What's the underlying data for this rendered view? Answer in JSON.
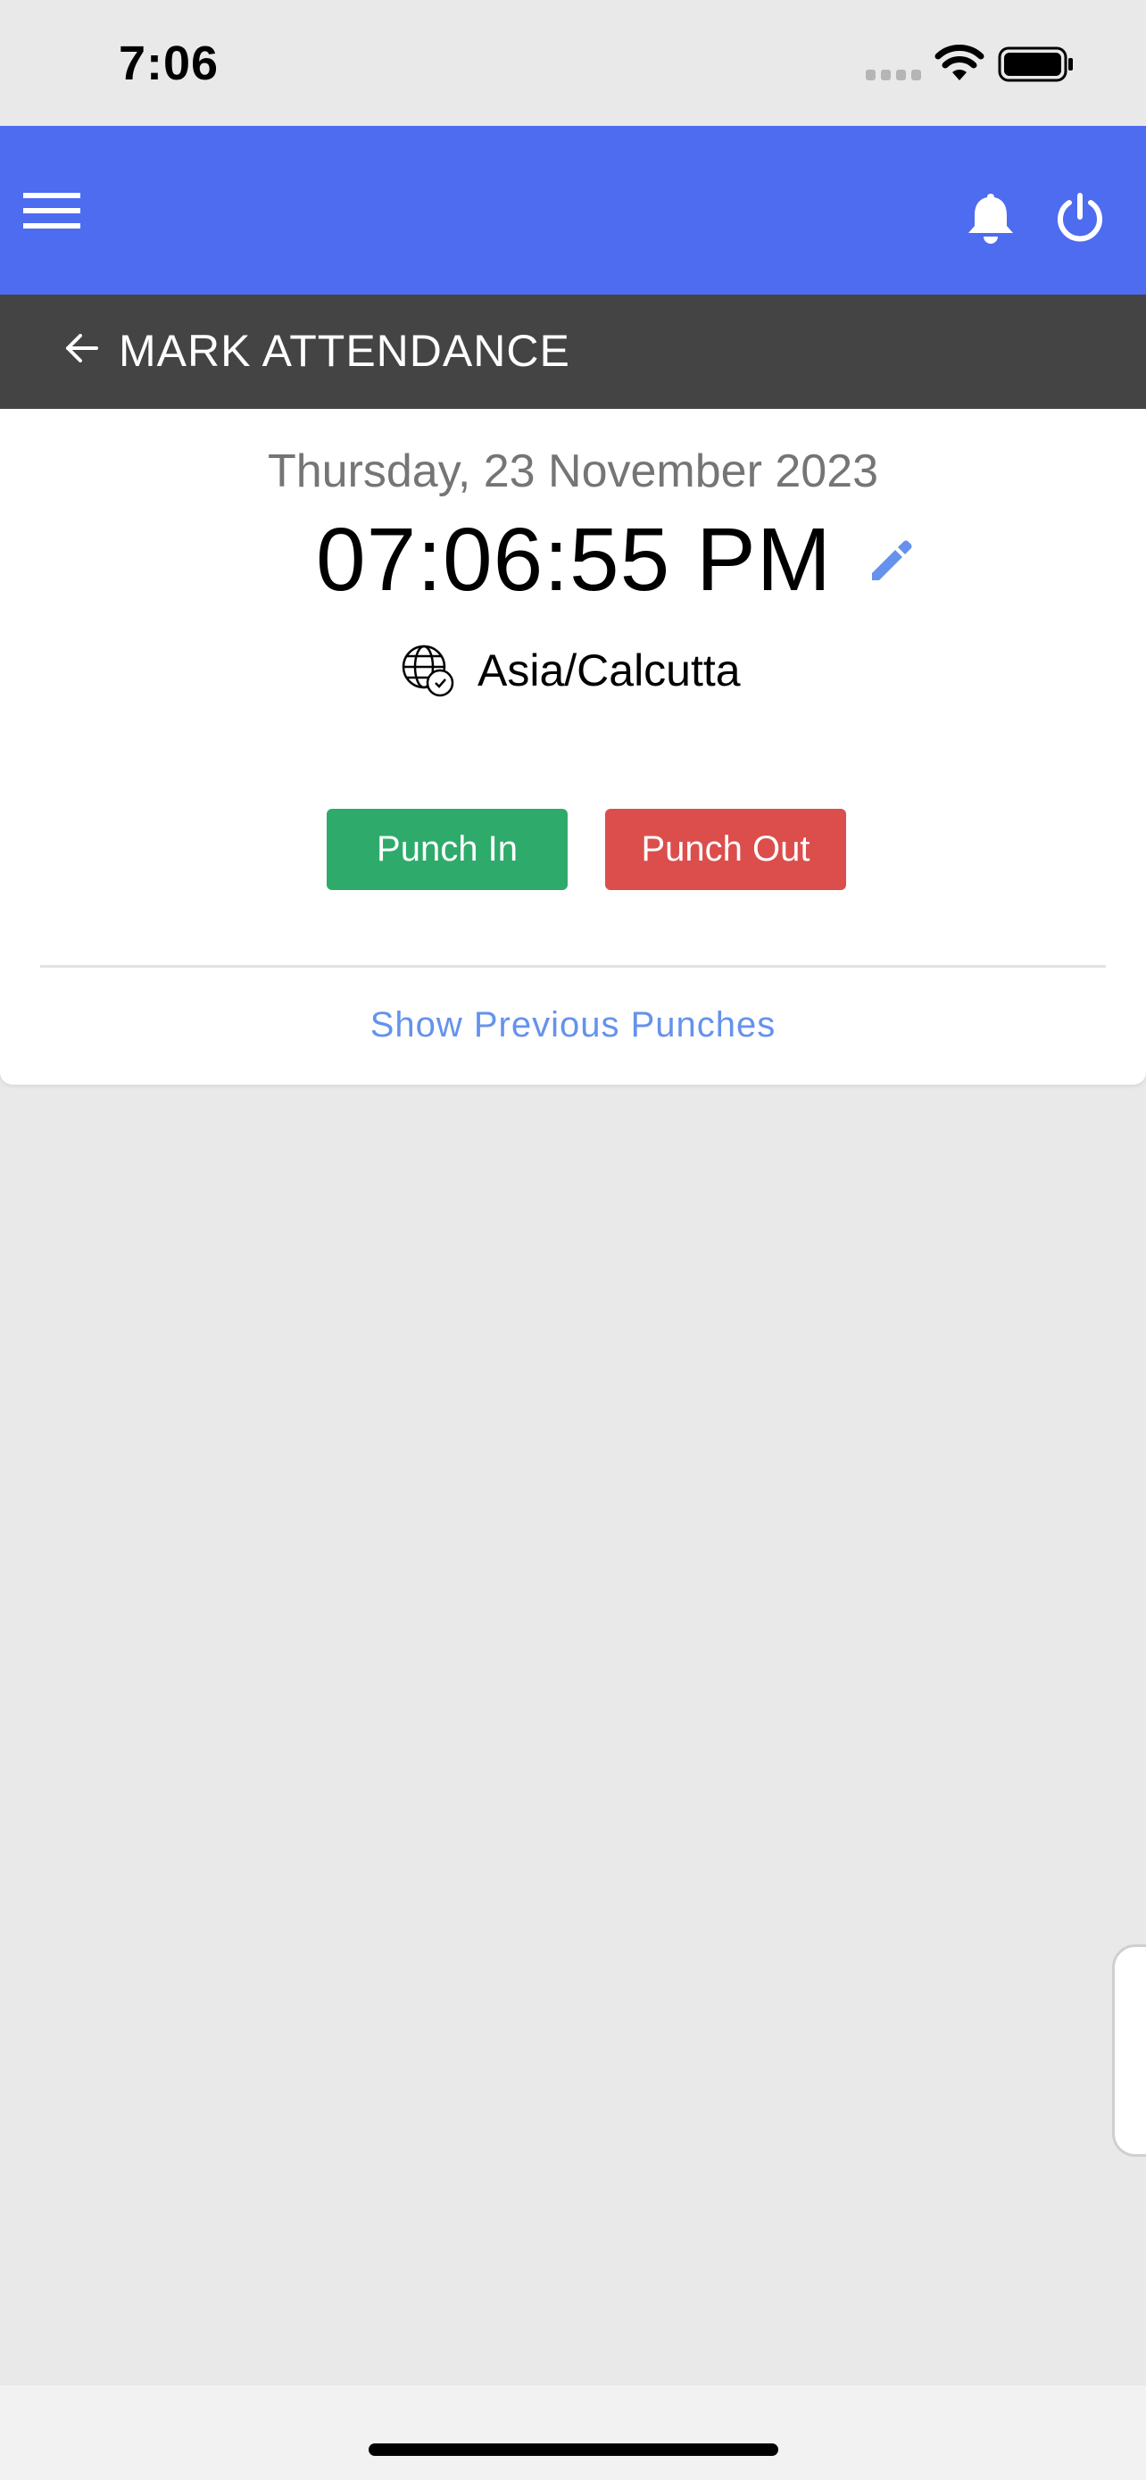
{
  "status_bar": {
    "time": "7:06"
  },
  "app_bar": {
    "background_color": "#4e6cf0",
    "icons": [
      "menu-icon",
      "bell-icon",
      "power-icon"
    ]
  },
  "sub_header": {
    "title": "MARK ATTENDANCE",
    "back_icon": "back-arrow-icon"
  },
  "attendance": {
    "date": "Thursday, 23 November 2023",
    "time": "07:06:55 PM",
    "timezone": "Asia/Calcutta",
    "punch_in_label": "Punch In",
    "punch_out_label": "Punch Out",
    "show_previous_label": "Show Previous Punches"
  },
  "colors": {
    "punch_in": "#2eab6a",
    "punch_out": "#db4e4c",
    "link": "#6592ec",
    "sub_header_bg": "#444444"
  }
}
